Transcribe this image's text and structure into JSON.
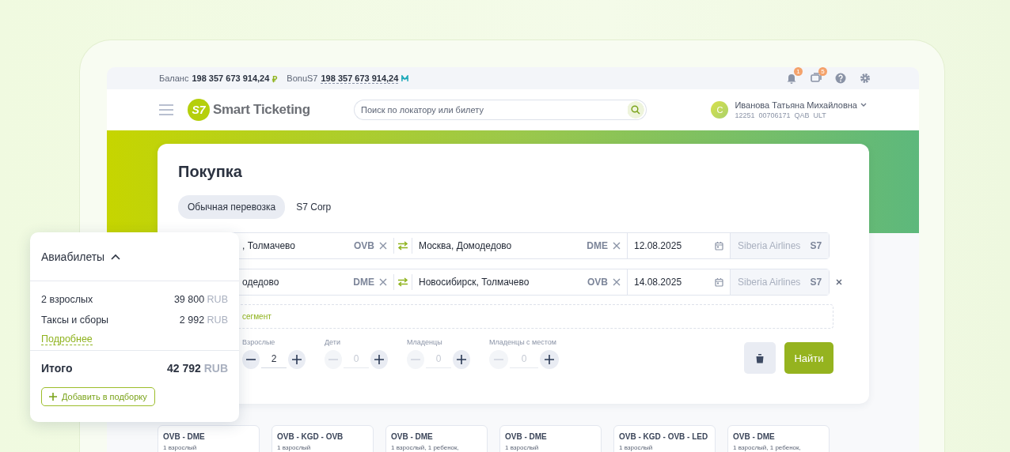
{
  "top_bar": {
    "balance_label": "Баланс",
    "balance": "198 357 673 914,24",
    "balance_currency": "₽",
    "bonus_label": "BonuS7",
    "bonus": "198 357 673 914,24",
    "icons": [
      {
        "kind": "bell",
        "badge": "1"
      },
      {
        "kind": "chat",
        "badge": "5"
      },
      {
        "kind": "help"
      },
      {
        "kind": "settings"
      }
    ]
  },
  "header": {
    "logo_mark": "S7",
    "logo_text": "Smart Ticketing",
    "search": {
      "placeholder": "Поиск по локатору или билету"
    },
    "user": {
      "initial": "С",
      "name": "Иванова Татьяна Михайловна",
      "details": "12251  00706171  QAB  ULT"
    }
  },
  "purchase": {
    "title": "Покупка",
    "tabs": [
      {
        "label": "Обычная перевозка",
        "selected": true
      },
      {
        "label": "S7 Corp",
        "selected": false
      }
    ],
    "segments": [
      {
        "origin": ", Толмачево",
        "origin_code": "OVB",
        "destination": "Москва, Домодедово",
        "destination_code": "DME",
        "date": "12.08.2025",
        "airline": "Siberia Airlines",
        "airline_code": "S7",
        "removable": false
      },
      {
        "origin": "одедово",
        "origin_code": "DME",
        "destination": "Новосибирск, Толмачево",
        "destination_code": "OVB",
        "date": "14.08.2025",
        "airline": "Siberia Airlines",
        "airline_code": "S7",
        "removable": true
      }
    ],
    "add_segment": "сегмент",
    "passengers": [
      {
        "label": "Взрослые",
        "value": "2",
        "decrement_disabled": false
      },
      {
        "label": "Дети",
        "value": "0",
        "decrement_disabled": true
      },
      {
        "label": "Младенцы",
        "value": "0",
        "decrement_disabled": true
      },
      {
        "label": "Младенцы с местом",
        "value": "0",
        "decrement_disabled": true
      }
    ],
    "search_button": "Найти"
  },
  "summary": {
    "title": "Авиабилеты",
    "expanded": true,
    "lines": [
      {
        "label": "2 взрослых",
        "amount": "39 800",
        "currency": "RUB"
      },
      {
        "label": "Таксы и сборы",
        "amount": "2 992",
        "currency": "RUB"
      }
    ],
    "details_link": "Подробнее",
    "total_label": "Итого",
    "total": "42 792",
    "total_currency": "RUB",
    "add_button": "Добавить в подборку"
  },
  "routes": [
    {
      "title": "OVB - DME",
      "subtitle": "1 взрослый"
    },
    {
      "title": "OVB - KGD - OVB",
      "subtitle": "1 взрослый"
    },
    {
      "title": "OVB - DME",
      "subtitle": "1 взрослый, 1 ребенок,"
    },
    {
      "title": "OVB - DME",
      "subtitle": "1 взрослый"
    },
    {
      "title": "OVB - KGD - OVB - LED",
      "subtitle": "1 взрослый"
    },
    {
      "title": "OVB - DME",
      "subtitle": "1 взрослый, 1 ребенок,"
    }
  ]
}
